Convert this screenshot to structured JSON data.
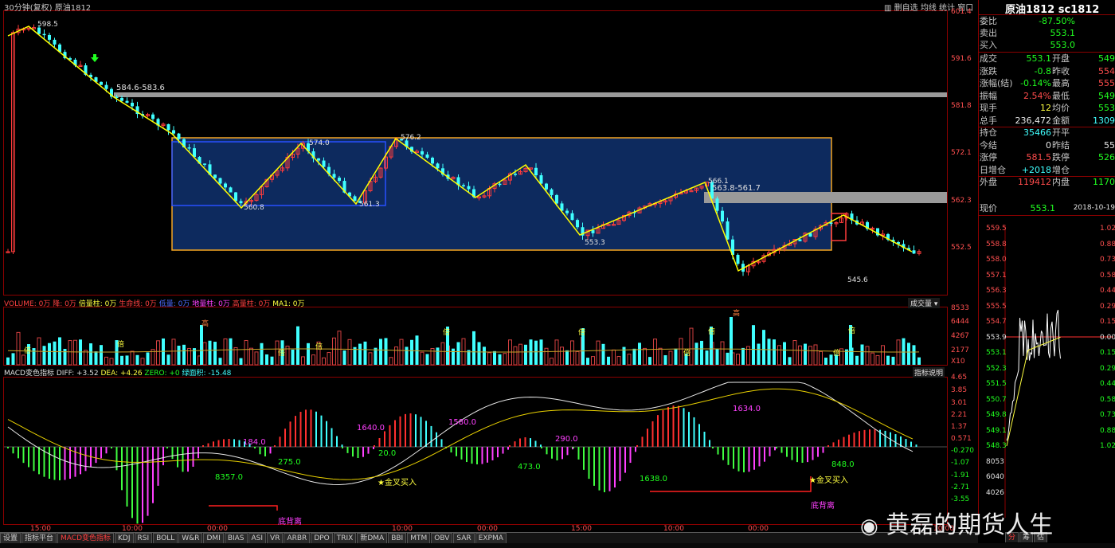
{
  "header": {
    "period": "30分钟(复权)",
    "symbol": "原油1812",
    "toolbar": [
      "删自选",
      "均线",
      "统计",
      "窗口"
    ],
    "toolbar_extra": "▥"
  },
  "main_chart": {
    "price_axis": [
      "601.4",
      "591.6",
      "581.8",
      "572.1",
      "562.3",
      "552.5"
    ],
    "annotations": [
      "598.5",
      "584.6-583.6",
      "574.0",
      "576.2",
      "560.8",
      "561.3",
      "566.1",
      "563.8-561.7",
      "553.3",
      "545.6"
    ]
  },
  "volume_chart": {
    "legend": [
      {
        "text": "VOLUME: 0万",
        "color": "#ff4040"
      },
      {
        "text": "降: 0万",
        "color": "#ff4040"
      },
      {
        "text": "倍量柱: 0万",
        "color": "#ffff40"
      },
      {
        "text": "生命线: 0万",
        "color": "#ff4040"
      },
      {
        "text": "低量: 0万",
        "color": "#4d6bff"
      },
      {
        "text": "地量柱: 0万",
        "color": "#ff40ff"
      },
      {
        "text": "高量柱: 0万",
        "color": "#ff4040"
      },
      {
        "text": "MA1: 0万",
        "color": "#ffff40"
      }
    ],
    "dropdown": "成交量",
    "axis": [
      "8533",
      "6444",
      "4267",
      "2177",
      "X10"
    ],
    "markers": [
      "倍",
      "倍",
      "高",
      "倍",
      "倍",
      "倍",
      "倍",
      "倍",
      "倍",
      "高",
      "倍",
      "倍"
    ]
  },
  "macd_chart": {
    "legend": [
      {
        "text": "MACD变色指标",
        "color": "#e0e0e0"
      },
      {
        "text": "DIFF: +3.52",
        "color": "#e0e0e0"
      },
      {
        "text": "DEA: +4.26",
        "color": "#ffff40"
      },
      {
        "text": "ZERO: +0",
        "color": "#20ff20"
      },
      {
        "text": "绿面积: -15.48",
        "color": "#40ffff"
      }
    ],
    "button": "指标说明",
    "axis": [
      "4.65",
      "3.85",
      "3.01",
      "2.21",
      "1.37",
      "0.571",
      "-0.270",
      "-1.07",
      "-1.91",
      "-2.71",
      "-3.55"
    ],
    "labels": [
      "184.0",
      "1640.0",
      "1580.0",
      "1634.0",
      "290.0",
      "275.0",
      "20.0",
      "473.0",
      "848.0",
      "8357.0",
      "1638.0"
    ],
    "golden_cross": "金叉买入",
    "divergence": "底背离"
  },
  "time_axis": [
    "15:00",
    "10:00",
    "00:00",
    "10:00",
    "00:00",
    "15:00",
    "10:00",
    "00:00",
    "10:00"
  ],
  "quote_panel": {
    "title": "原油1812 sc1812",
    "rows": [
      {
        "label": "委比",
        "value": "-87.50%",
        "vcolor": "#20ff20"
      },
      {
        "label": "卖出",
        "value": "553.1",
        "vcolor": "#20ff20"
      },
      {
        "label": "买入",
        "value": "553.0",
        "vcolor": "#20ff20"
      }
    ],
    "rows2": [
      {
        "label": "成交",
        "value": "553.1",
        "vcolor": "#20ff20",
        "label2": "开盘",
        "value2": "549",
        "v2color": "#20ff20"
      },
      {
        "label": "涨跌",
        "value": "-0.8",
        "vcolor": "#20ff20",
        "label2": "昨收",
        "value2": "554",
        "v2color": "#ff4c4c"
      },
      {
        "label": "涨幅(结)",
        "value": "-0.14%",
        "vcolor": "#20ff20",
        "label2": "最高",
        "value2": "555",
        "v2color": "#ff4c4c"
      },
      {
        "label": "振幅",
        "value": "2.54%",
        "vcolor": "#ff4c4c",
        "label2": "最低",
        "value2": "549",
        "v2color": "#20ff20"
      },
      {
        "label": "现手",
        "value": "12",
        "vcolor": "#ffff40",
        "label2": "均价",
        "value2": "553",
        "v2color": "#20ff20"
      },
      {
        "label": "总手",
        "value": "236,472",
        "vcolor": "#e8e8e8",
        "label2": "金额",
        "value2": "1309",
        "v2color": "#40ffff"
      },
      {
        "label": "持仓",
        "value": "35466",
        "vcolor": "#40ffff",
        "label2": "开平",
        "value2": "",
        "v2color": "#e8e8e8"
      },
      {
        "label": "今结",
        "value": "0",
        "vcolor": "#e8e8e8",
        "label2": "昨结",
        "value2": "55",
        "v2color": "#e8e8e8"
      },
      {
        "label": "涨停",
        "value": "581.5",
        "vcolor": "#ff4c4c",
        "label2": "跌停",
        "value2": "526",
        "v2color": "#20ff20"
      },
      {
        "label": "日增仓",
        "value": "+2018",
        "vcolor": "#40ffff",
        "label2": "增仓",
        "value2": "",
        "v2color": "#e8e8e8"
      },
      {
        "label": "外盘",
        "value": "119412",
        "vcolor": "#ff4c4c",
        "label2": "内盘",
        "value2": "1170",
        "v2color": "#20ff20"
      }
    ],
    "current_label": "现价",
    "current_value": "553.1",
    "date": "2018-10-19",
    "mini_axis_left": [
      "559.5",
      "558.8",
      "558.0",
      "557.1",
      "556.3",
      "555.5",
      "554.7",
      "553.9",
      "553.1",
      "552.3",
      "551.5",
      "550.7",
      "549.8",
      "549.1",
      "548.3",
      "8053",
      "6040",
      "4026"
    ],
    "mini_axis_right": [
      "1.02",
      "0.88",
      "0.73",
      "0.58",
      "0.44",
      "0.29",
      "0.15",
      "0.00",
      "0.15",
      "0.29",
      "0.44",
      "0.58",
      "0.73",
      "0.88",
      "1.02"
    ],
    "tabs": [
      "分",
      "筹",
      "估"
    ]
  },
  "bottom_tabs": [
    {
      "label": "设置",
      "active": false
    },
    {
      "label": "指标平台",
      "active": false
    },
    {
      "label": "MACD变色指标",
      "active": true
    },
    {
      "label": "KDJ",
      "active": false
    },
    {
      "label": "RSI",
      "active": false
    },
    {
      "label": "BOLL",
      "active": false
    },
    {
      "label": "W&R",
      "active": false
    },
    {
      "label": "DMI",
      "active": false
    },
    {
      "label": "BIAS",
      "active": false
    },
    {
      "label": "ASI",
      "active": false
    },
    {
      "label": "VR",
      "active": false
    },
    {
      "label": "ARBR",
      "active": false
    },
    {
      "label": "DPO",
      "active": false
    },
    {
      "label": "TRIX",
      "active": false
    },
    {
      "label": "新DMA",
      "active": false
    },
    {
      "label": "BBI",
      "active": false
    },
    {
      "label": "MTM",
      "active": false
    },
    {
      "label": "OBV",
      "active": false
    },
    {
      "label": "SAR",
      "active": false
    },
    {
      "label": "EXPMA",
      "active": false
    }
  ],
  "watermark": "黄磊的期货人生",
  "colors": {
    "up": "#ff3c3c",
    "down": "#40ffff",
    "zigzag": "#ffff00",
    "box": "#f5a623",
    "box_fill": "#0d2a5e",
    "resistance": "#9a9a9a"
  }
}
